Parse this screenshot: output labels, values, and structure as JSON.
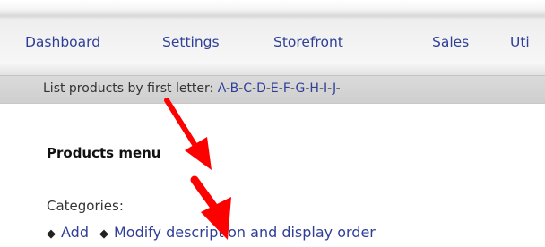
{
  "nav": {
    "items": [
      "Dashboard",
      "Settings",
      "Storefront",
      "Sales",
      "Uti"
    ]
  },
  "letter_strip": {
    "prefix": "List products by first letter:",
    "letters": [
      "A",
      "B",
      "C",
      "D",
      "E",
      "F",
      "G",
      "H",
      "I",
      "J"
    ]
  },
  "products_menu": {
    "title": "Products menu",
    "categories_label": "Categories:",
    "bullet_glyph": "◆",
    "links": [
      "Add",
      "Modify description and display order"
    ]
  },
  "annotation": {
    "arrow_color": "#ff0000"
  }
}
